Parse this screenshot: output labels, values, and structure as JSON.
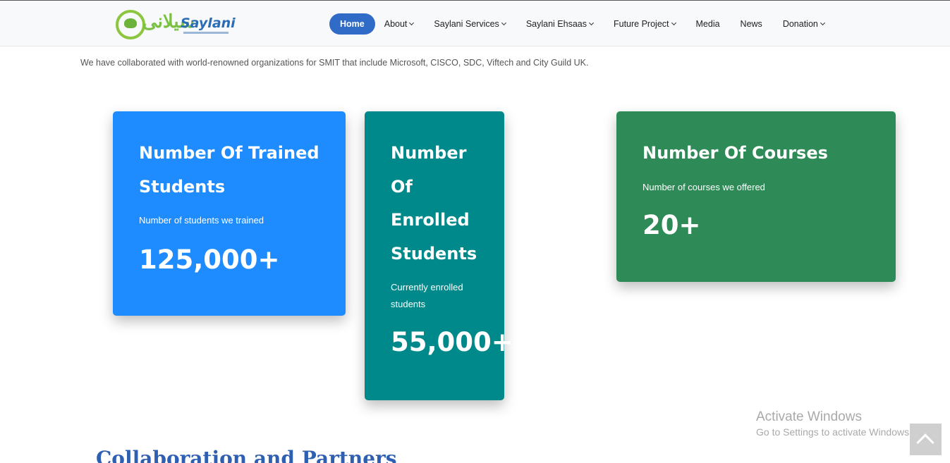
{
  "header": {
    "logo_text": "Saylani",
    "logo_urdu": "سیلانی",
    "logo_sub": "ویلفیئر ٹرسٹ",
    "nav": [
      {
        "label": "Home",
        "active": true,
        "dropdown": false
      },
      {
        "label": "About",
        "active": false,
        "dropdown": true
      },
      {
        "label": "Saylani Services",
        "active": false,
        "dropdown": true
      },
      {
        "label": "Saylani Ehsaas",
        "active": false,
        "dropdown": true
      },
      {
        "label": "Future Project",
        "active": false,
        "dropdown": true
      },
      {
        "label": "Media",
        "active": false,
        "dropdown": false
      },
      {
        "label": "News",
        "active": false,
        "dropdown": false
      },
      {
        "label": "Donation",
        "active": false,
        "dropdown": true
      }
    ]
  },
  "intro": "We have collaborated with world-renowned organizations for SMIT that include Microsoft, CISCO, SDC, Viftech and City Guild UK.",
  "cards": {
    "trained": {
      "title": "Number Of Trained Students",
      "desc": "Number of students we trained",
      "value": "125,000+",
      "color": "#1e8cff"
    },
    "enrolled": {
      "title_lines": [
        "Number",
        "Of",
        "Enrolled",
        "Students"
      ],
      "desc": "Currently enrolled students",
      "value": "55,000+",
      "color": "#00898a"
    },
    "courses": {
      "title": "Number Of Courses",
      "desc": "Number of courses we offered",
      "value": "20+",
      "color": "#2e8b57"
    }
  },
  "section_title": "Collaboration and Partners",
  "watermark": {
    "line1": "Activate Windows",
    "line2": "Go to Settings to activate Windows."
  },
  "icons": {
    "scroll_top": "chevron-up-icon",
    "caret": "chevron-down-icon"
  }
}
